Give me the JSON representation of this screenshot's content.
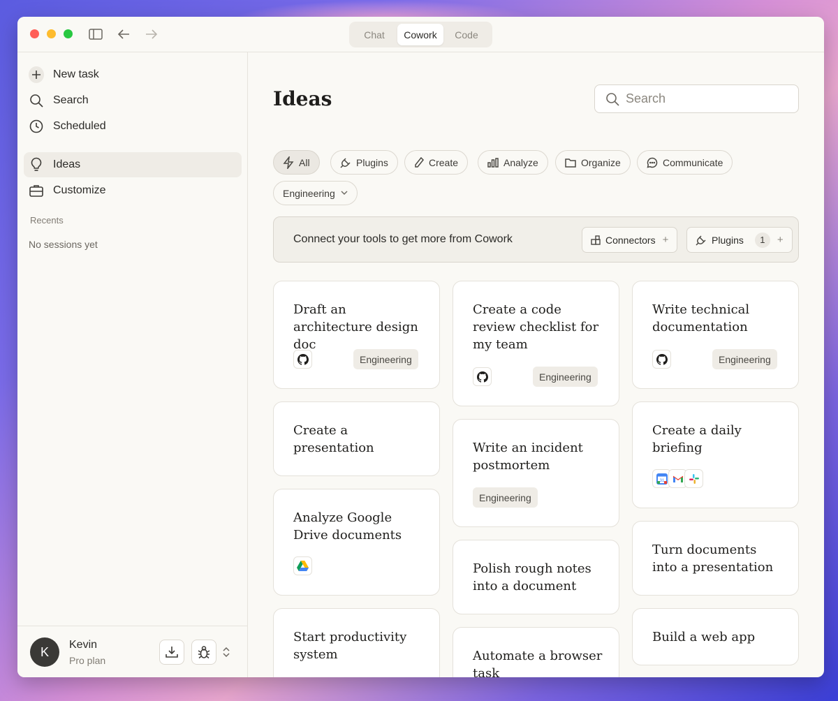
{
  "titlebar": {
    "modes": [
      "Chat",
      "Cowork",
      "Code"
    ]
  },
  "sidebar": {
    "new_task": "New task",
    "search": "Search",
    "scheduled": "Scheduled",
    "ideas": "Ideas",
    "customize": "Customize",
    "recents_label": "Recents",
    "no_sessions": "No sessions yet",
    "user": {
      "initial": "K",
      "name": "Kevin",
      "plan": "Pro plan"
    }
  },
  "main": {
    "title": "Ideas",
    "search_placeholder": "Search",
    "filters": {
      "all": "All",
      "plugins": "Plugins",
      "create": "Create",
      "analyze": "Analyze",
      "organize": "Organize",
      "communicate": "Communicate",
      "engineering": "Engineering"
    },
    "banner": {
      "text": "Connect your tools to get more from Cowork",
      "connectors": "Connectors",
      "plugins": "Plugins",
      "plugins_count": "1"
    },
    "cards": [
      {
        "title": "Draft an architecture design doc",
        "tag": "Engineering",
        "icons": [
          "github-icon"
        ]
      },
      {
        "title": "Create a code review checklist for my team",
        "tag": "Engineering",
        "icons": [
          "github-icon"
        ]
      },
      {
        "title": "Write technical documentation",
        "tag": "Engineering",
        "icons": [
          "github-icon"
        ]
      },
      {
        "title": "Create a presentation"
      },
      {
        "title": "Write an incident postmortem",
        "tag": "Engineering"
      },
      {
        "title": "Create a daily briefing",
        "icons": [
          "google-calendar-icon",
          "gmail-icon",
          "slack-icon"
        ]
      },
      {
        "title": "Analyze Google Drive documents",
        "icons": [
          "google-drive-icon"
        ]
      },
      {
        "title": "Polish rough notes into a document"
      },
      {
        "title": "Turn documents into a presentation"
      },
      {
        "title": "Start productivity system"
      },
      {
        "title": "Automate a browser task"
      },
      {
        "title": "Build a web app"
      }
    ]
  },
  "colors": {
    "window_bg": "#faf9f5",
    "accent_dark": "#1f1e1c",
    "chip_active": "#ebe8e2"
  }
}
